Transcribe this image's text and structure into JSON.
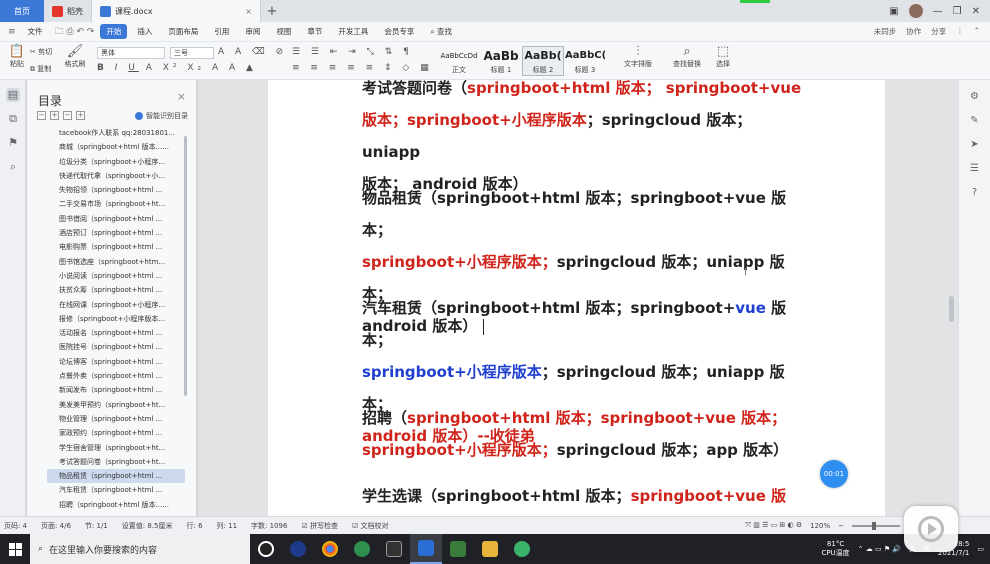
{
  "tabs": {
    "home": "首页",
    "wps": "稻壳",
    "doc": "课程.docx"
  },
  "menu": {
    "file": "文件",
    "items": [
      "开始",
      "插入",
      "页面布局",
      "引用",
      "审阅",
      "视图",
      "章节",
      "开发工具",
      "会员专享"
    ],
    "search": "查找",
    "right": [
      "未同步",
      "协作",
      "分享"
    ]
  },
  "ribbon": {
    "paste": "粘贴",
    "cut": "剪切",
    "copy": "复制",
    "format_painter": "格式刷",
    "font_name": "黑体",
    "font_size": "三号",
    "styles": [
      {
        "sample": "AaBbCcDd",
        "label": "正文"
      },
      {
        "sample": "AaBb",
        "label": "标题 1"
      },
      {
        "sample": "AaBb(",
        "label": "标题 2"
      },
      {
        "sample": "AaBbC(",
        "label": "标题 3"
      }
    ],
    "text_layout": "文字排版",
    "find_replace": "查找替换",
    "select": "选择"
  },
  "toc": {
    "title": "目录",
    "smart": "智能识别目录",
    "items": [
      "tacebook作人联系 qq:28031801...",
      "商城（springboot+html 版本......",
      "垃圾分类（springboot+小程序...",
      "快递代取代拿（springboot+小...",
      "失物招领（springboot+html ...",
      "二手交易市场（springboot+ht...",
      "图书借阅（springboot+html ...",
      "酒店预订（springboot+html ...",
      "电影购票（springboot+html ...",
      "图书馆选座（springboot+htm...",
      "小说阅读（springboot+html ...",
      "扶贫众筹（springboot+html ...",
      "在线网课（springboot+小程序...",
      "报修（springboot+小程序版本...",
      "活动报名（springboot+html ...",
      "医院挂号（springboot+html ...",
      "论坛博客（springboot+html ...",
      "点餐外卖（springboot+html ...",
      "新闻发布（springboot+html ...",
      "美发美甲预约（springboot+ht...",
      "物业管理（springboot+html ...",
      "家政预约（springboot+html ...",
      "学生宿舍管理（springboot+ht...",
      "考试答题问卷（springboot+ht...",
      "物品租赁（springboot+html ...",
      "汽车租赁（springboot+html ...",
      "招聘（springboot+html 版本......"
    ],
    "selected_index": 24
  },
  "document": {
    "p1": {
      "l1a": "考试答题问卷（",
      "l1b": "springboot+html 版本； springboot+vue",
      "l2a": "版本；springboot+小程序版本",
      "l2b": "；springcloud 版本；uniapp",
      "l3": "版本； android 版本）"
    },
    "p2": {
      "l1": "物品租赁（springboot+html 版本；springboot+vue 版本；",
      "l2a": "springboot+小程序版本；",
      "l2b": "springcloud 版本；uniapp 版本；",
      "l3": "android 版本）"
    },
    "p3": {
      "l1a": "汽车租赁（springboot+html 版本；springboot+",
      "l1b": "vue",
      "l1c": " 版本；",
      "l2a": "springboot+小程序版本",
      "l2b": "；springcloud 版本；uniapp 版本；",
      "l3a": "android 版本）",
      "l3b": "--收徒弟"
    },
    "p4": {
      "l1a": "招聘（",
      "l1b": "springboot+html 版本；springboot+vue 版本；",
      "l2a": "springboot+小程序版本；",
      "l2b": "springcloud 版本；app 版本）"
    },
    "p5": {
      "l1a": "学生选课（springboot+html 版本；",
      "l1b": "springboot+vue 版本；"
    },
    "timer": "00:01"
  },
  "status": {
    "page": "页码: 4",
    "pages": "页面: 4/6",
    "section": "节: 1/1",
    "setting": "设置值: 8.5厘米",
    "row": "行: 6",
    "col": "列: 11",
    "words": "字数: 1096",
    "spell": "拼写检查",
    "proof": "文档校对",
    "zoom": "120%"
  },
  "taskbar": {
    "search_placeholder": "在这里输入你要搜索的内容",
    "temp": "81°C",
    "temp_label": "CPU温度",
    "lang": "英",
    "time": "18:5",
    "date": "2021/7/1"
  }
}
